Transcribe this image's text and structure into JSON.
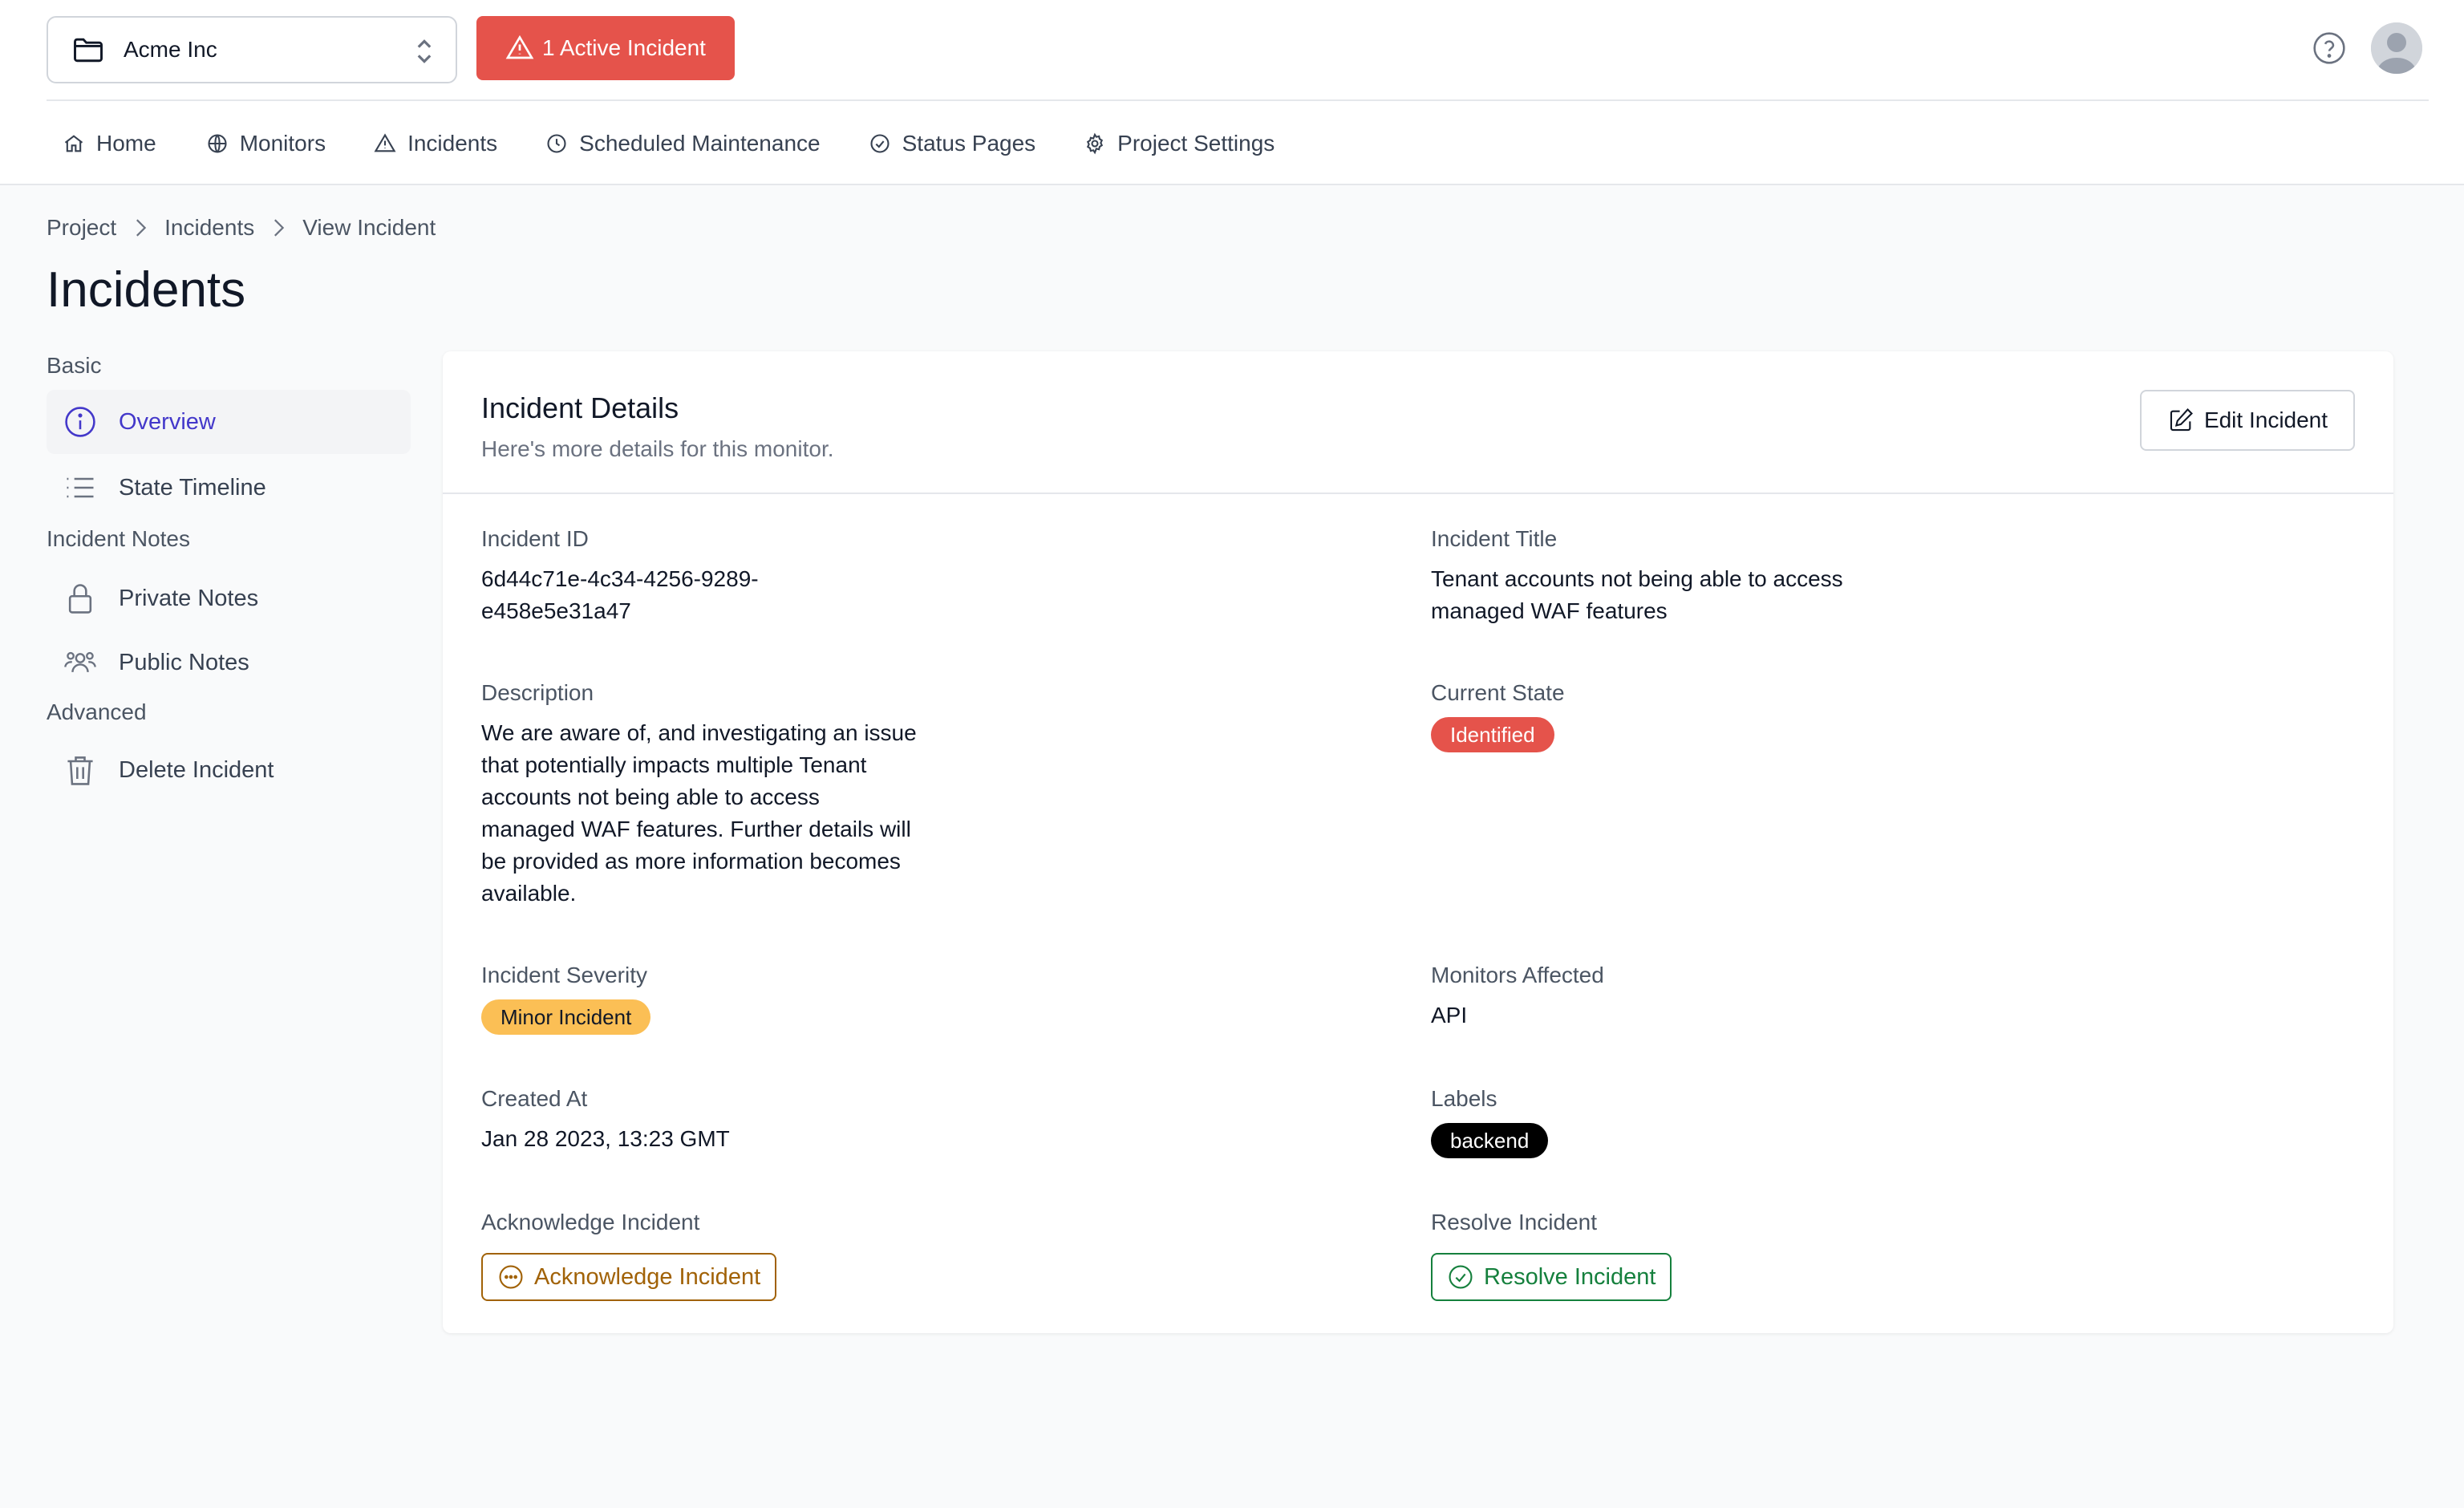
{
  "header": {
    "project_name": "Acme Inc",
    "active_incident_label": "1 Active Incident"
  },
  "nav": {
    "items": [
      {
        "label": "Home",
        "icon": "home-icon"
      },
      {
        "label": "Monitors",
        "icon": "globe-icon"
      },
      {
        "label": "Incidents",
        "icon": "alert-triangle-icon"
      },
      {
        "label": "Scheduled Maintenance",
        "icon": "clock-icon"
      },
      {
        "label": "Status Pages",
        "icon": "check-circle-icon"
      },
      {
        "label": "Project Settings",
        "icon": "gear-icon"
      }
    ]
  },
  "breadcrumb": [
    "Project",
    "Incidents",
    "View Incident"
  ],
  "page_title": "Incidents",
  "sidebar": {
    "groups": [
      {
        "label": "Basic",
        "items": [
          {
            "label": "Overview",
            "icon": "info-icon",
            "active": true
          },
          {
            "label": "State Timeline",
            "icon": "list-icon",
            "active": false
          }
        ]
      },
      {
        "label": "Incident Notes",
        "items": [
          {
            "label": "Private Notes",
            "icon": "lock-icon",
            "active": false
          },
          {
            "label": "Public Notes",
            "icon": "users-icon",
            "active": false
          }
        ]
      },
      {
        "label": "Advanced",
        "items": [
          {
            "label": "Delete Incident",
            "icon": "trash-icon",
            "active": false
          }
        ]
      }
    ]
  },
  "card": {
    "title": "Incident Details",
    "description": "Here's more details for this monitor.",
    "edit_label": "Edit Incident",
    "fields": {
      "incident_id": {
        "label": "Incident ID",
        "value_line1": "6d44c71e-4c34-4256-9289-",
        "value_line2": "e458e5e31a47"
      },
      "incident_title": {
        "label": "Incident Title",
        "value_line1": "Tenant accounts not being able to access",
        "value_line2": "managed WAF features"
      },
      "description": {
        "label": "Description",
        "lines": [
          "We are aware of, and investigating an issue",
          "that potentially impacts multiple Tenant",
          "accounts not being able to access",
          "managed WAF features. Further details will",
          "be provided as more information becomes",
          "available."
        ]
      },
      "current_state": {
        "label": "Current State",
        "value": "Identified"
      },
      "severity": {
        "label": "Incident Severity",
        "value": "Minor Incident"
      },
      "monitors_affected": {
        "label": "Monitors Affected",
        "value": "API"
      },
      "created_at": {
        "label": "Created At",
        "value": "Jan 28 2023, 13:23 GMT"
      },
      "labels": {
        "label": "Labels",
        "value": "backend"
      },
      "acknowledge": {
        "label": "Acknowledge Incident",
        "button": "Acknowledge Incident"
      },
      "resolve": {
        "label": "Resolve Incident",
        "button": "Resolve Incident"
      }
    }
  },
  "colors": {
    "incident_red": "#e5534b",
    "active_indigo": "#4338ca",
    "identified_badge": "#e5534b",
    "minor_badge": "#fbbf55",
    "label_badge": "#000000",
    "acknowledge": "#a16207",
    "resolve": "#15803d"
  }
}
